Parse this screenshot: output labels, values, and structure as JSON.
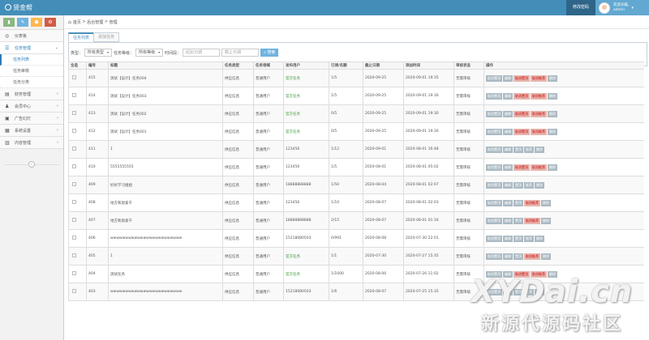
{
  "app": {
    "brand": "贤金帮"
  },
  "header": {
    "password_label": "修改密码",
    "welcome": "欢迎光临,",
    "username": "admin"
  },
  "sidebar": {
    "shortcuts": [
      {
        "icon": "signal-icon",
        "color": "#87b87f",
        "glyph": "▮"
      },
      {
        "icon": "pencil-icon",
        "color": "#6fb3e0",
        "glyph": "✎"
      },
      {
        "icon": "users-icon",
        "color": "#ffb752",
        "glyph": "☗"
      },
      {
        "icon": "cogs-icon",
        "color": "#d15b47",
        "glyph": "⚙"
      }
    ],
    "items": [
      {
        "label": "仪表板",
        "icon": "dashboard-icon",
        "glyph": "◎"
      },
      {
        "label": "任务管理",
        "icon": "task-icon",
        "glyph": "☰",
        "arrow": "⌄",
        "active": true,
        "children": [
          {
            "label": "任务列表",
            "active": true
          },
          {
            "label": "任务审核"
          },
          {
            "label": "任务分类"
          }
        ]
      },
      {
        "label": "财务管理",
        "icon": "finance-icon",
        "glyph": "▤",
        "arrow": "›"
      },
      {
        "label": "会员中心",
        "icon": "user-icon",
        "glyph": "♟",
        "arrow": "›"
      },
      {
        "label": "广告幻灯",
        "icon": "image-icon",
        "glyph": "▣",
        "arrow": "›"
      },
      {
        "label": "系统设置",
        "icon": "settings-icon",
        "glyph": "▦",
        "arrow": "›"
      },
      {
        "label": "内容管理",
        "icon": "book-icon",
        "glyph": "▥",
        "arrow": "›"
      }
    ]
  },
  "breadcrumb": {
    "home": "首页",
    "sep1": ">",
    "section": "后台管理",
    "sep2": ">",
    "page": "管理"
  },
  "tabs": [
    {
      "label": "任务列表",
      "active": true
    },
    {
      "label": "添加任务"
    }
  ],
  "filters": {
    "type_label": "类型：",
    "type_value": "所有类型",
    "level_label": "任务等级：",
    "level_value": "所有等级",
    "time_label": "时间段：",
    "start_placeholder": "起始日期",
    "end_placeholder": "截止日期",
    "search_label": "搜索"
  },
  "table": {
    "headers": [
      "全选",
      "编号",
      "标题",
      "任务类型",
      "任务领域",
      "发布用户",
      "已领/名额",
      "截止日期",
      "添加时间",
      "审核状态",
      "操作"
    ],
    "rows": [
      {
        "id": "415",
        "title": "测试【设计】任务004",
        "type": "供应信息",
        "domain": "普通用户",
        "user": "官方任务",
        "official": true,
        "quota": "1/5",
        "deadline": "2020-09-25",
        "added": "2020-09-01 19:35",
        "status": "无需审核",
        "ops": [
          "取消置顶",
          "编辑",
          "取消置顶",
          "取消推荐",
          "删除"
        ],
        "ops_red": [
          false,
          false,
          true,
          true,
          false
        ]
      },
      {
        "id": "414",
        "title": "测试【设计】任务003",
        "type": "供应信息",
        "domain": "普通用户",
        "user": "官方任务",
        "official": true,
        "quota": "1/5",
        "deadline": "2020-09-25",
        "added": "2020-09-01 19:30",
        "status": "无需审核",
        "ops": [
          "取消置顶",
          "编辑",
          "取消置顶",
          "取消推荐",
          "删除"
        ],
        "ops_red": [
          false,
          false,
          true,
          true,
          false
        ]
      },
      {
        "id": "413",
        "title": "测试【设计】任务002",
        "type": "供应信息",
        "domain": "普通用户",
        "user": "官方任务",
        "official": true,
        "quota": "0/5",
        "deadline": "2020-09-25",
        "added": "2020-09-01 19:30",
        "status": "无需审核",
        "ops": [
          "取消置顶",
          "编辑",
          "取消置顶",
          "取消推荐",
          "删除"
        ],
        "ops_red": [
          false,
          false,
          true,
          true,
          false
        ]
      },
      {
        "id": "412",
        "title": "测试【设计】任务001",
        "type": "供应信息",
        "domain": "普通用户",
        "user": "官方任务",
        "official": true,
        "quota": "0/5",
        "deadline": "2020-09-25",
        "added": "2020-09-01 19:30",
        "status": "无需审核",
        "ops": [
          "取消置顶",
          "编辑",
          "取消置顶",
          "取消推荐",
          "删除"
        ],
        "ops_red": [
          false,
          false,
          true,
          true,
          false
        ]
      },
      {
        "id": "411",
        "title": "1",
        "type": "供应信息",
        "domain": "普通用户",
        "user": "123456",
        "official": false,
        "quota": "1/12",
        "deadline": "2020-09-01",
        "added": "2020-08-01 16:48",
        "status": "无需审核",
        "ops": [
          "取消置顶",
          "编辑",
          "置顶",
          "推荐",
          "删除"
        ],
        "ops_red": [
          false,
          false,
          false,
          false,
          false
        ]
      },
      {
        "id": "410",
        "title": "5555555555",
        "type": "供应信息",
        "domain": "普通用户",
        "user": "123456",
        "official": false,
        "quota": "1/5",
        "deadline": "2020-08-01",
        "added": "2020-08-01 05:02",
        "status": "无需审核",
        "ops": [
          "取消置顶",
          "编辑",
          "取消置顶",
          "取消推荐",
          "删除"
        ],
        "ops_red": [
          false,
          false,
          true,
          true,
          false
        ]
      },
      {
        "id": "409",
        "title": "好好学习姐姐",
        "type": "供应信息",
        "domain": "普通用户",
        "user": "18888888888",
        "official": false,
        "quota": "1/50",
        "deadline": "2020-08-04",
        "added": "2020-08-01 02:07",
        "status": "无需审核",
        "ops": [
          "取消置顶",
          "编辑",
          "置顶",
          "推荐",
          "删除"
        ],
        "ops_red": [
          false,
          false,
          false,
          false,
          false
        ]
      },
      {
        "id": "408",
        "title": "地方和恩爱干",
        "type": "供应信息",
        "domain": "普通用户",
        "user": "123456",
        "official": false,
        "quota": "1/10",
        "deadline": "2020-08-07",
        "added": "2020-08-01 02:03",
        "status": "无需审核",
        "ops": [
          "取消置顶",
          "编辑",
          "置顶",
          "取消推荐",
          "删除"
        ],
        "ops_red": [
          false,
          false,
          false,
          true,
          false
        ]
      },
      {
        "id": "407",
        "title": "地方和恩爱干",
        "type": "供应信息",
        "domain": "普通用户",
        "user": "18888888888",
        "official": false,
        "quota": "2/15",
        "deadline": "2020-08-07",
        "added": "2020-08-01 01:16",
        "status": "无需审核",
        "ops": [
          "取消置顶",
          "编辑",
          "置顶",
          "取消推荐",
          "删除"
        ],
        "ops_red": [
          false,
          false,
          false,
          true,
          false
        ]
      },
      {
        "id": "406",
        "title": "wwwwwwwwwwwwwwwwwwwwwwww",
        "type": "供应信息",
        "domain": "普通用户",
        "user": "15218080503",
        "official": false,
        "quota": "0/991",
        "deadline": "2020-08-08",
        "added": "2020-07-30 22:01",
        "status": "无需审核",
        "ops": [
          "取消置顶",
          "编辑",
          "置顶",
          "推荐",
          "删除"
        ],
        "ops_red": [
          false,
          false,
          false,
          false,
          false
        ]
      },
      {
        "id": "405",
        "title": "1",
        "type": "供应信息",
        "domain": "普通用户",
        "user": "官方任务",
        "official": true,
        "quota": "1/1",
        "deadline": "2020-07-30",
        "added": "2020-07-27 15:35",
        "status": "无需审核",
        "ops": [
          "取消置顶",
          "编辑",
          "置顶",
          "取消推荐",
          "删除"
        ],
        "ops_red": [
          false,
          false,
          false,
          true,
          false
        ]
      },
      {
        "id": "404",
        "title": "测试任务",
        "type": "供应信息",
        "domain": "普通用户",
        "user": "官方任务",
        "official": true,
        "quota": "1/1000",
        "deadline": "2020-08-06",
        "added": "2020-07-26 11:02",
        "status": "无需审核",
        "ops": [
          "取消置顶",
          "编辑",
          "取消置顶",
          "取消推荐",
          "删除"
        ],
        "ops_red": [
          false,
          false,
          true,
          true,
          false
        ]
      },
      {
        "id": "403",
        "title": "wwwwwwwwwwwwwwwwwwwwwwww",
        "type": "供应信息",
        "domain": "普通用户",
        "user": "15218080503",
        "official": false,
        "quota": "1/6",
        "deadline": "2020-08-07",
        "added": "2020-07-25 15:35",
        "status": "无需审核",
        "ops": [
          "取消置顶",
          "编辑",
          "置顶",
          "推荐",
          "删除"
        ],
        "ops_red": [
          false,
          false,
          false,
          false,
          false
        ]
      }
    ]
  },
  "watermark": {
    "line1": "XYDai.cn",
    "line2": "新源代源码社区"
  }
}
